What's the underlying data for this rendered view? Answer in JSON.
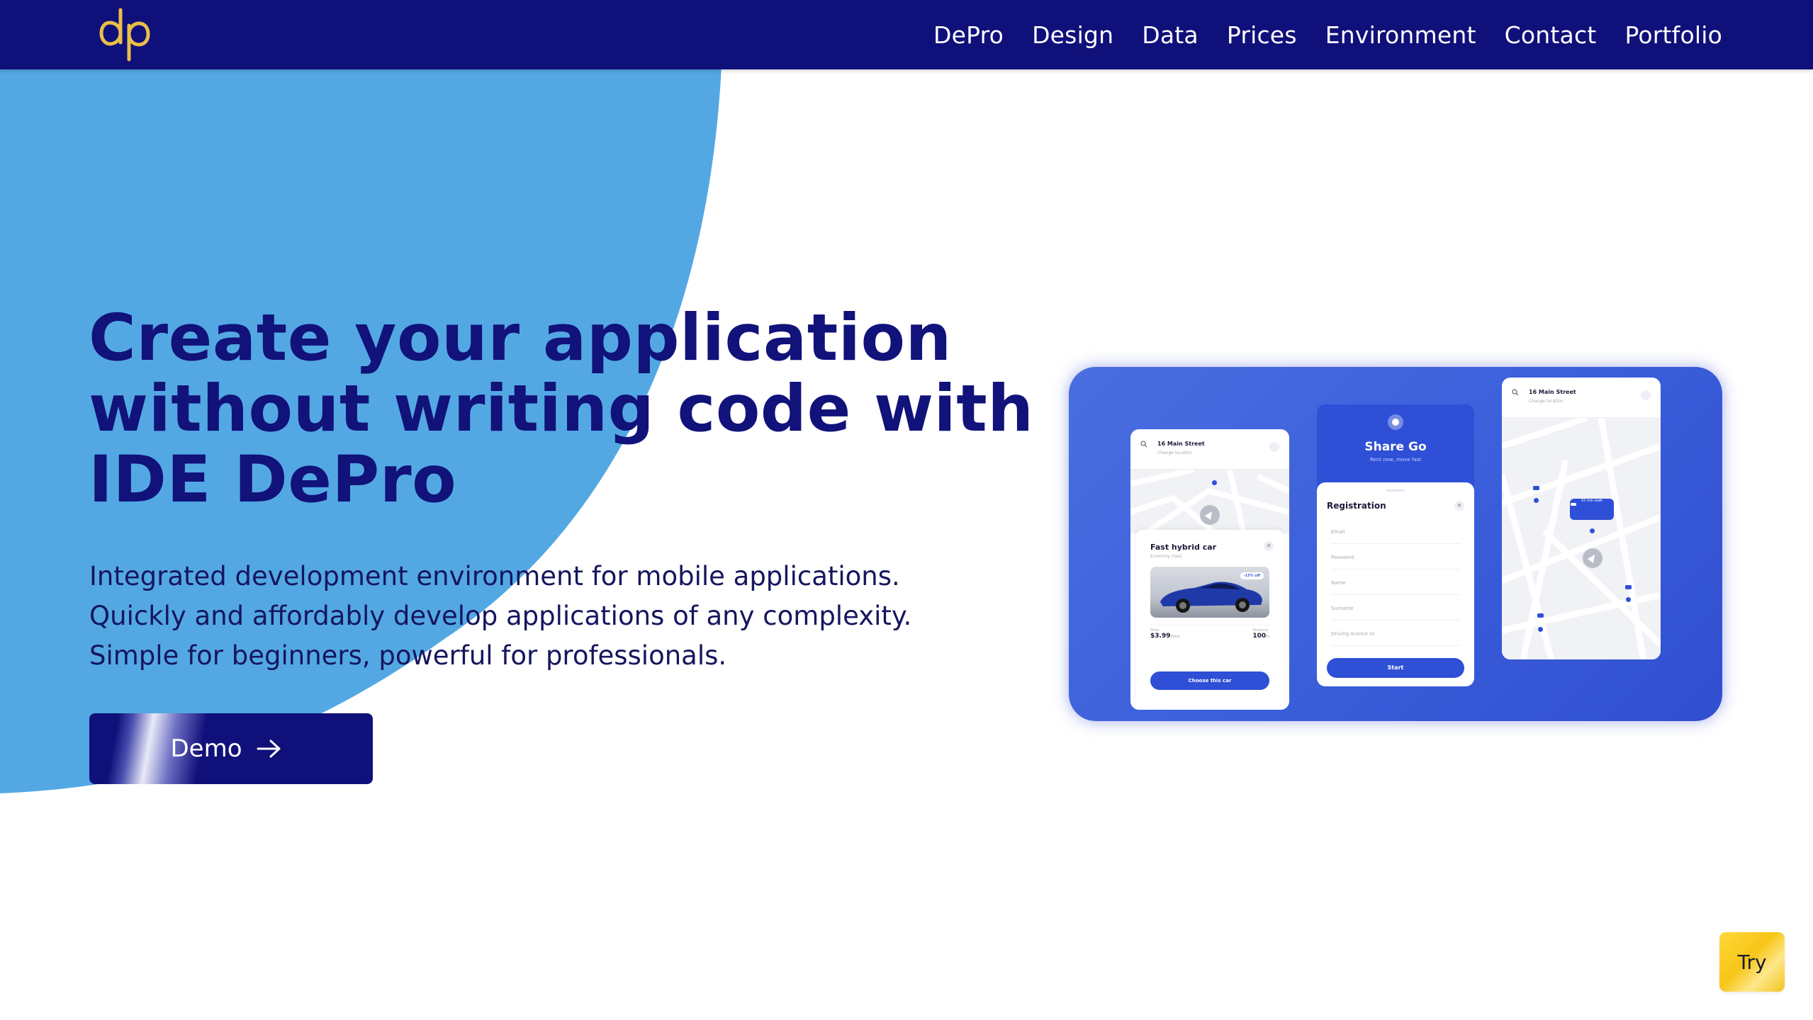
{
  "header": {
    "logo_text": "dp",
    "nav": [
      "DePro",
      "Design",
      "Data",
      "Prices",
      "Environment",
      "Contact",
      "Portfolio"
    ]
  },
  "hero": {
    "title_lines": [
      "Create your application",
      "without writing code with",
      "IDE DePro"
    ],
    "description_lines": [
      "Integrated development environment for mobile applications.",
      "Quickly and affordably develop applications of any complexity.",
      "Simple for beginners, powerful for professionals."
    ],
    "demo_label": "Demo"
  },
  "mockup": {
    "phone1": {
      "street": "16 Main Street",
      "change": "Change location",
      "car_title": "Fast hybrid car",
      "car_class": "Economy class",
      "discount": "-15% off",
      "price_label": "Price",
      "price_value": "$3.99",
      "price_unit": "/hour",
      "distance_label": "Distance",
      "distance_value": "100",
      "distance_unit": "m",
      "choose_label": "Choose this car"
    },
    "phone2": {
      "app_name": "Share Go",
      "tagline": "Rent now, move fast",
      "form_title": "Registration",
      "fields": [
        "Email",
        "Password",
        "Name",
        "Surname",
        "Driving licence nr."
      ],
      "start_label": "Start"
    },
    "phone3": {
      "street": "16 Main Street",
      "change": "Change location",
      "walk_label": "15 min walk"
    }
  },
  "try_label": "Try",
  "colors": {
    "navy": "#10107a",
    "hero_blue": "#53a8e3",
    "card_blue": "#3c5fdb",
    "logo_gold": "#e9bf47",
    "try_yellow": "#f7c517"
  },
  "icons": [
    "dp-logo",
    "arrow-right-icon",
    "search-icon",
    "menu-icon",
    "close-icon",
    "location-arrow-icon",
    "car-icon"
  ]
}
